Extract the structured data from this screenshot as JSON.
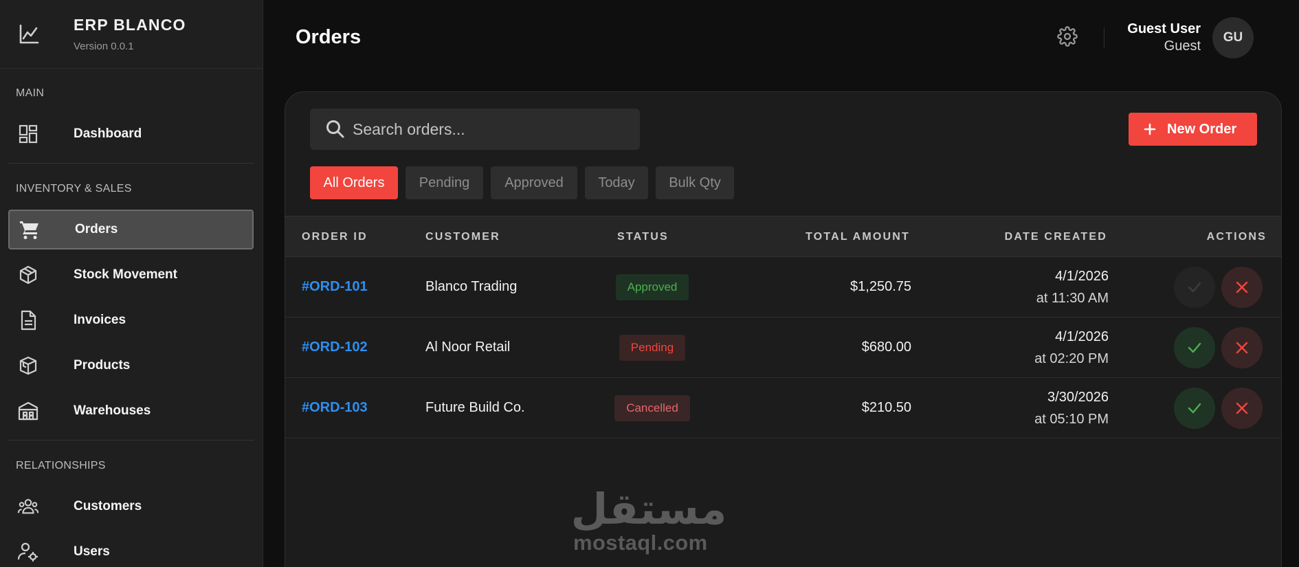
{
  "app": {
    "brand_title": "ERP BLANCO",
    "brand_version": "Version 0.0.1"
  },
  "sidebar": {
    "sections": [
      {
        "label": "MAIN"
      },
      {
        "label": "INVENTORY & SALES"
      },
      {
        "label": "RELATIONSHIPS"
      }
    ],
    "items": [
      {
        "label": "Dashboard",
        "icon": "dashboard-icon"
      },
      {
        "label": "Orders",
        "icon": "cart-icon",
        "active": true
      },
      {
        "label": "Stock Movement",
        "icon": "box-icon"
      },
      {
        "label": "Invoices",
        "icon": "document-icon"
      },
      {
        "label": "Products",
        "icon": "cube-icon"
      },
      {
        "label": "Warehouses",
        "icon": "warehouse-icon"
      },
      {
        "label": "Customers",
        "icon": "group-icon"
      },
      {
        "label": "Users",
        "icon": "user-cog-icon"
      }
    ]
  },
  "header": {
    "title": "Orders",
    "user_name": "Guest User",
    "user_role": "Guest",
    "avatar_initials": "GU"
  },
  "toolbar": {
    "search_placeholder": "Search orders...",
    "new_order_label": "New Order"
  },
  "filters": [
    {
      "label": "All Orders",
      "active": true
    },
    {
      "label": "Pending"
    },
    {
      "label": "Approved"
    },
    {
      "label": "Today"
    },
    {
      "label": "Bulk Qty"
    }
  ],
  "table": {
    "columns": [
      "ORDER ID",
      "CUSTOMER",
      "STATUS",
      "TOTAL AMOUNT",
      "DATE CREATED",
      "ACTIONS"
    ],
    "rows": [
      {
        "id": "#ORD-101",
        "customer": "Blanco Trading",
        "status": "Approved",
        "status_kind": "approved",
        "amount": "$1,250.75",
        "date": "4/1/2026",
        "time": "at 11:30 AM",
        "approve_enabled": false
      },
      {
        "id": "#ORD-102",
        "customer": "Al Noor Retail",
        "status": "Pending",
        "status_kind": "pending",
        "amount": "$680.00",
        "date": "4/1/2026",
        "time": "at 02:20 PM",
        "approve_enabled": true
      },
      {
        "id": "#ORD-103",
        "customer": "Future Build Co.",
        "status": "Cancelled",
        "status_kind": "cancelled",
        "amount": "$210.50",
        "date": "3/30/2026",
        "time": "at 05:10 PM",
        "approve_enabled": true
      }
    ]
  },
  "watermark": {
    "arabic": "مستقل",
    "latin": "mostaql.com"
  },
  "colors": {
    "accent": "#f2453d",
    "link": "#2d8ff0",
    "success": "#4caf50",
    "danger": "#f2453d"
  }
}
